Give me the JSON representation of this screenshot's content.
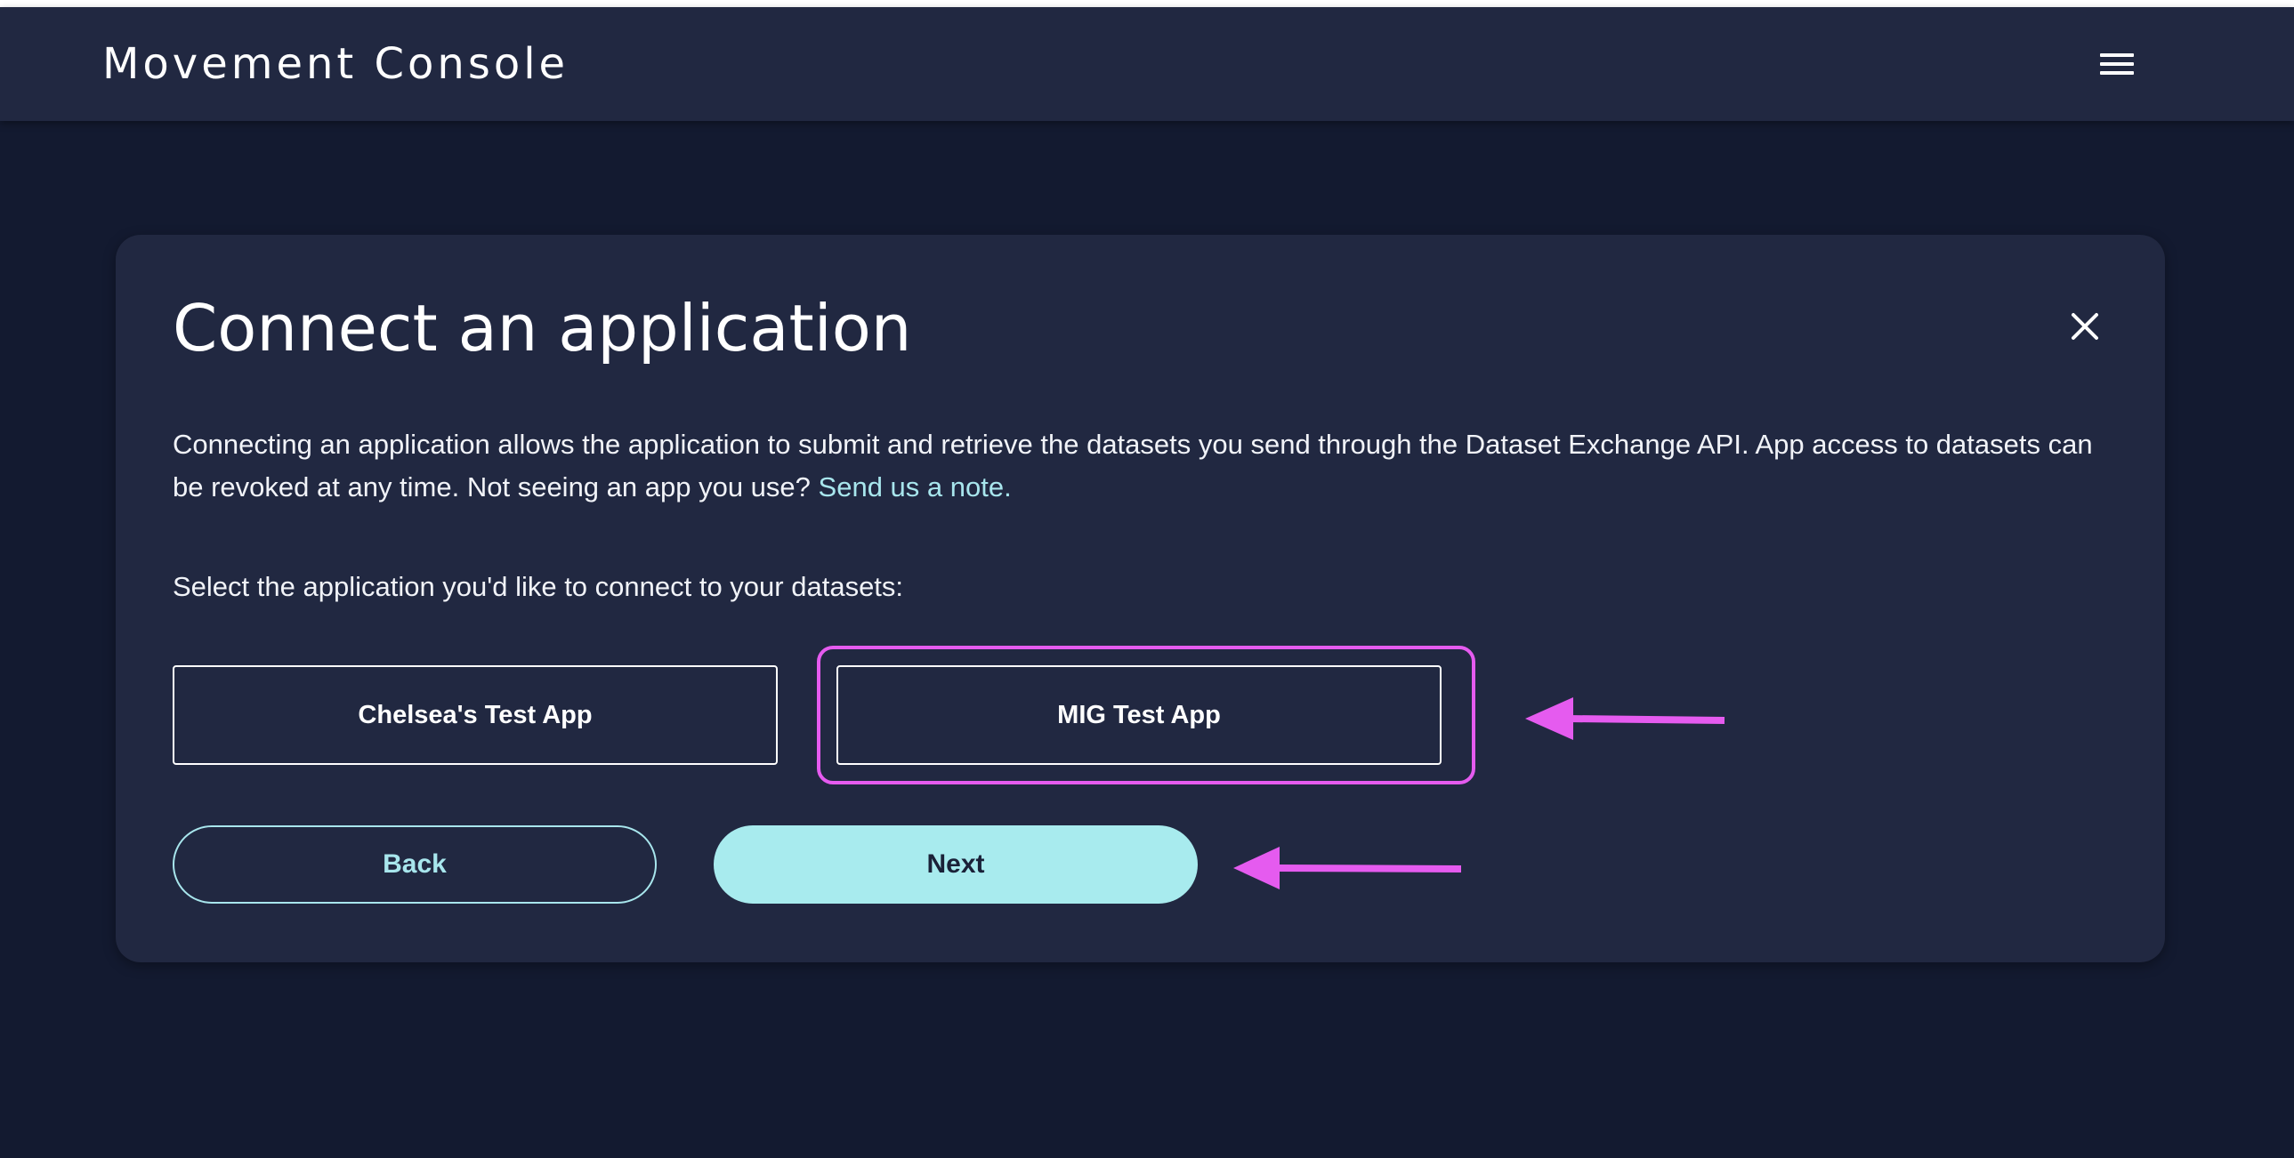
{
  "header": {
    "brand": "Movement Console",
    "menu_icon": "hamburger-menu-icon"
  },
  "dialog": {
    "title": "Connect an application",
    "close_icon": "close-icon",
    "description": "Connecting an application allows the application to submit and retrieve the datasets you send through the Dataset Exchange API. App access to datasets can be revoked at any time. Not seeing an app you use?",
    "link_text": "Send us a note.",
    "prompt": "Select the application you'd like to connect to your datasets:",
    "apps": [
      {
        "label": "Chelsea's Test App"
      },
      {
        "label": "MIG Test App"
      }
    ],
    "back_label": "Back",
    "next_label": "Next"
  },
  "colors": {
    "page_background": "#131a30",
    "surface": "#212841",
    "accent": "#a8ebee",
    "annotation": "#e55bef"
  }
}
